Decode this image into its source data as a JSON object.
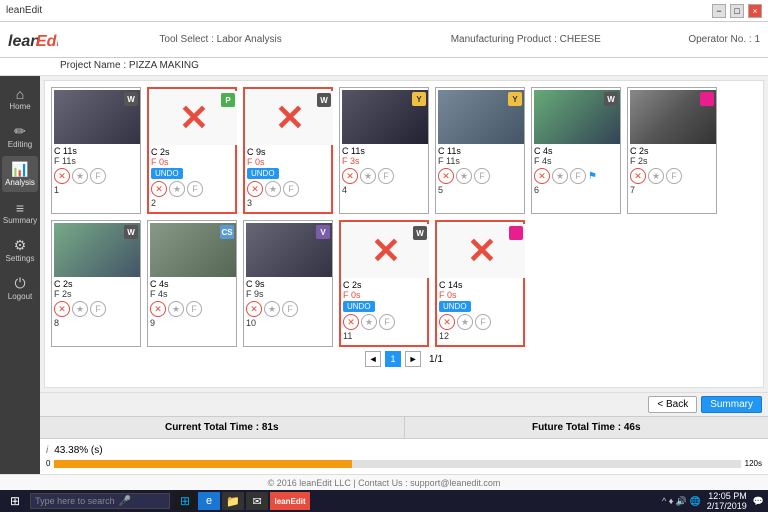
{
  "titlebar": {
    "app_name": "leanEdit",
    "minimize": "−",
    "maximize": "□",
    "close": "×"
  },
  "header": {
    "tool_select": "Tool Select : Labor Analysis",
    "mfg_product": "Manufacturing Product : CHEESE",
    "operator": "Operator No. : 1",
    "project_name": "Project Name : PIZZA MAKING"
  },
  "sidebar": {
    "items": [
      {
        "label": "Home",
        "icon": "⌂"
      },
      {
        "label": "Editing",
        "icon": "✏"
      },
      {
        "label": "Analysis",
        "icon": "📊"
      },
      {
        "label": "Summary",
        "icon": "≡"
      },
      {
        "label": "Settings",
        "icon": "⚙"
      },
      {
        "label": "Logout",
        "icon": "⏻"
      }
    ]
  },
  "cards": [
    {
      "id": 1,
      "has_thumb": false,
      "deleted": false,
      "c_time": "C 11s",
      "badge": "W",
      "badge_class": "badge-w",
      "f_time": "F 11s",
      "f_class": "normal",
      "number": "1",
      "show_undo": false
    },
    {
      "id": 2,
      "has_thumb": false,
      "deleted": true,
      "c_time": "C 2s",
      "badge": "P",
      "badge_class": "badge-p",
      "f_time": "F 0s",
      "f_class": "red",
      "number": "2",
      "show_undo": true
    },
    {
      "id": 3,
      "has_thumb": false,
      "deleted": true,
      "c_time": "C 9s",
      "badge": "W",
      "badge_class": "badge-w",
      "f_time": "F 0s",
      "f_class": "red",
      "number": "3",
      "show_undo": true
    },
    {
      "id": 4,
      "has_thumb": true,
      "deleted": false,
      "c_time": "C 11s",
      "badge": "Y",
      "badge_class": "badge-y",
      "f_time": "F 3s",
      "f_class": "red",
      "number": "4",
      "show_undo": false
    },
    {
      "id": 5,
      "has_thumb": true,
      "deleted": false,
      "c_time": "C 11s",
      "badge": "Y",
      "badge_class": "badge-y",
      "f_time": "F 11s",
      "f_class": "normal",
      "number": "5",
      "show_undo": false
    },
    {
      "id": 6,
      "has_thumb": true,
      "deleted": false,
      "c_time": "C 4s",
      "badge": "W",
      "badge_class": "badge-w",
      "f_time": "F 4s",
      "f_class": "normal",
      "number": "6",
      "show_undo": false,
      "has_flag": true
    },
    {
      "id": 7,
      "has_thumb": true,
      "deleted": false,
      "c_time": "C 2s",
      "badge": "pink",
      "badge_class": "badge-pink",
      "f_time": "F 2s",
      "f_class": "normal",
      "number": "7",
      "show_undo": false
    },
    {
      "id": 8,
      "has_thumb": true,
      "deleted": false,
      "c_time": "C 2s",
      "badge": "W",
      "badge_class": "badge-w",
      "f_time": "F 2s",
      "f_class": "normal",
      "number": "8",
      "show_undo": false
    },
    {
      "id": 9,
      "has_thumb": true,
      "deleted": false,
      "c_time": "C 4s",
      "badge": "CS",
      "badge_class": "badge-cs",
      "f_time": "F 4s",
      "f_class": "normal",
      "number": "9",
      "show_undo": false
    },
    {
      "id": 10,
      "has_thumb": true,
      "deleted": false,
      "c_time": "C 9s",
      "badge": "V",
      "badge_class": "badge-v",
      "f_time": "F 9s",
      "f_class": "normal",
      "number": "10",
      "show_undo": false
    },
    {
      "id": 11,
      "has_thumb": false,
      "deleted": true,
      "c_time": "C 2s",
      "badge": "W",
      "badge_class": "badge-w",
      "f_time": "F 0s",
      "f_class": "red",
      "number": "11",
      "show_undo": true
    },
    {
      "id": 12,
      "has_thumb": false,
      "deleted": true,
      "c_time": "C 14s",
      "badge": "pink",
      "badge_class": "badge-pink",
      "f_time": "F 0s",
      "f_class": "red",
      "number": "12",
      "show_undo": true
    }
  ],
  "pagination": {
    "prev": "◄",
    "next": "►",
    "current": 1,
    "total": "1/1"
  },
  "toolbar": {
    "back_label": "< Back",
    "summary_label": "Summary"
  },
  "stats": {
    "current_total": "Current Total Time : 81s",
    "future_total": "Future Total Time : 46s"
  },
  "progress": {
    "label": "i",
    "percent_label": "43.38% (s)",
    "percent_value": 43.38,
    "bar_max": "120s",
    "bar_max2": "120s"
  },
  "footer": {
    "text": "© 2016 leanEdit LLC | Contact Us : support@leanedit.com"
  },
  "taskbar": {
    "search_placeholder": "Type here to search",
    "time": "12:05 PM",
    "date": "2/17/2019"
  }
}
